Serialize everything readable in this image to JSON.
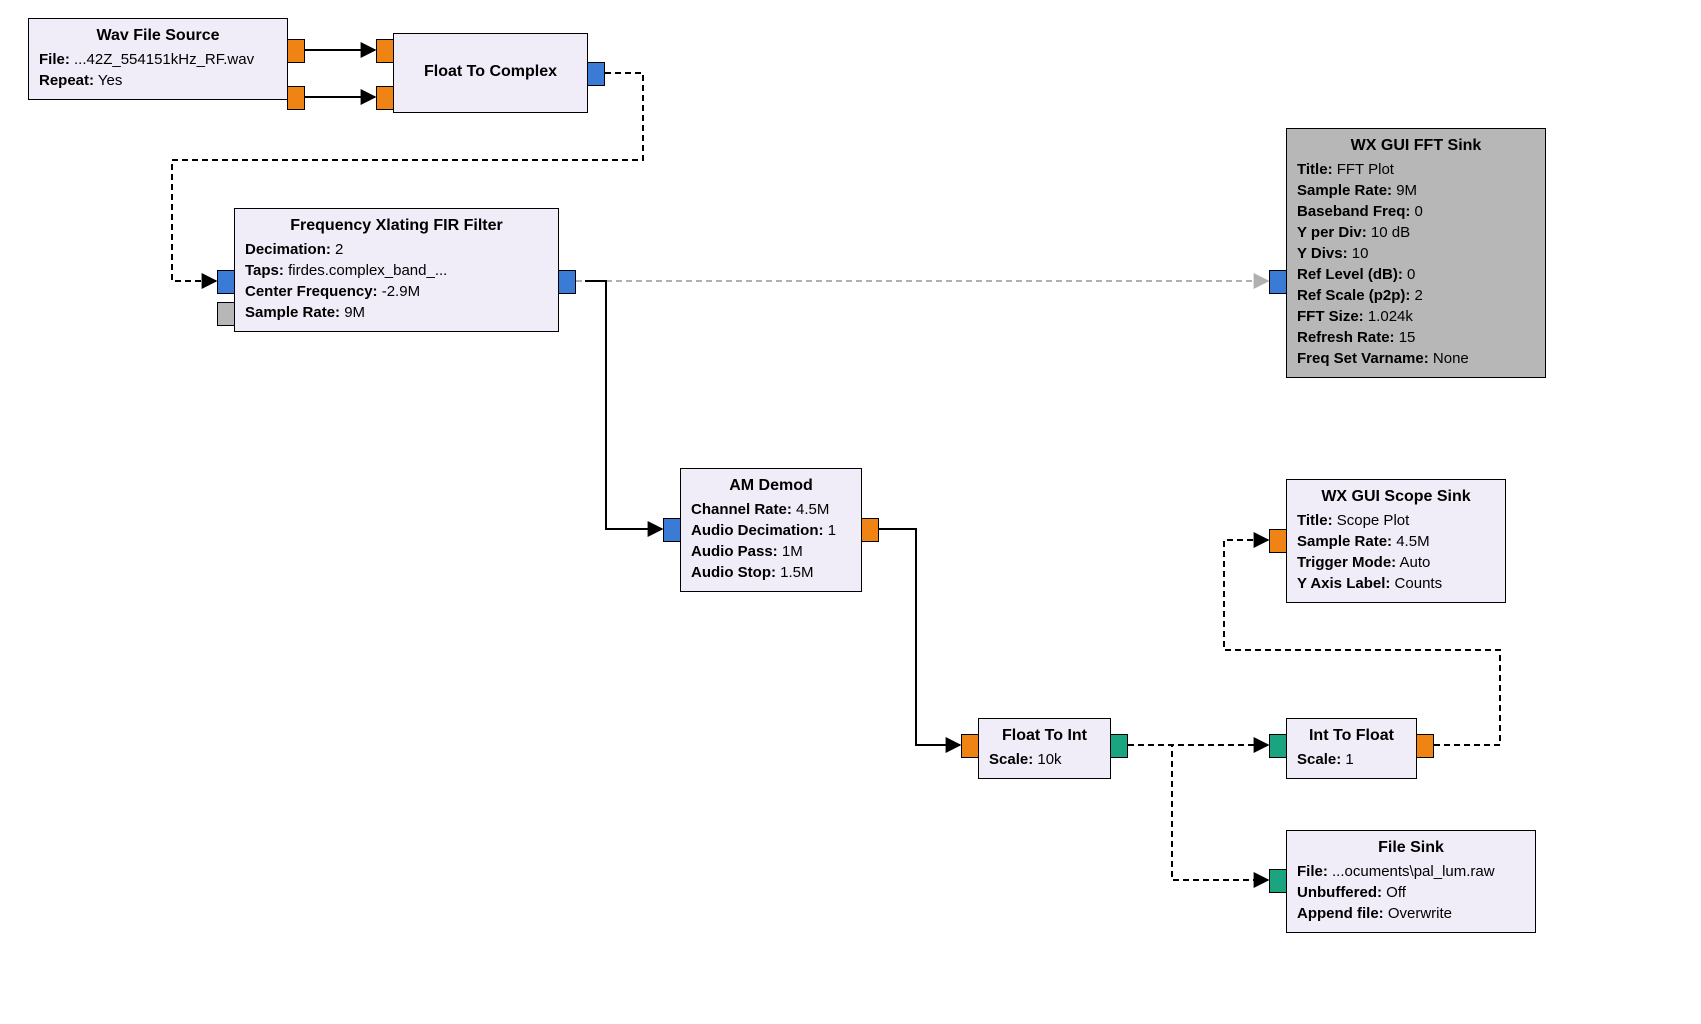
{
  "blocks": {
    "wav": {
      "title": "Wav File Source",
      "props": [
        {
          "k": "File:",
          "v": "...42Z_554151kHz_RF.wav"
        },
        {
          "k": "Repeat:",
          "v": "Yes"
        }
      ]
    },
    "f2c": {
      "title": "Float To Complex",
      "props": []
    },
    "xlate": {
      "title": "Frequency Xlating FIR Filter",
      "props": [
        {
          "k": "Decimation:",
          "v": "2"
        },
        {
          "k": "Taps:",
          "v": "firdes.complex_band_..."
        },
        {
          "k": "Center Frequency:",
          "v": "-2.9M"
        },
        {
          "k": "Sample Rate:",
          "v": "9M"
        }
      ]
    },
    "fft": {
      "title": "WX GUI FFT Sink",
      "props": [
        {
          "k": "Title:",
          "v": "FFT Plot"
        },
        {
          "k": "Sample Rate:",
          "v": "9M"
        },
        {
          "k": "Baseband Freq:",
          "v": "0"
        },
        {
          "k": "Y per Div:",
          "v": "10 dB"
        },
        {
          "k": "Y Divs:",
          "v": "10"
        },
        {
          "k": "Ref Level (dB):",
          "v": "0"
        },
        {
          "k": "Ref Scale (p2p):",
          "v": "2"
        },
        {
          "k": "FFT Size:",
          "v": "1.024k"
        },
        {
          "k": "Refresh Rate:",
          "v": "15"
        },
        {
          "k": "Freq Set Varname:",
          "v": "None"
        }
      ]
    },
    "amdemod": {
      "title": "AM Demod",
      "props": [
        {
          "k": "Channel Rate:",
          "v": "4.5M"
        },
        {
          "k": "Audio Decimation:",
          "v": "1"
        },
        {
          "k": "Audio Pass:",
          "v": "1M"
        },
        {
          "k": "Audio Stop:",
          "v": "1.5M"
        }
      ]
    },
    "scope": {
      "title": "WX GUI Scope Sink",
      "props": [
        {
          "k": "Title:",
          "v": "Scope Plot"
        },
        {
          "k": "Sample Rate:",
          "v": "4.5M"
        },
        {
          "k": "Trigger Mode:",
          "v": "Auto"
        },
        {
          "k": "Y Axis Label:",
          "v": "Counts"
        }
      ]
    },
    "f2i": {
      "title": "Float To Int",
      "props": [
        {
          "k": "Scale:",
          "v": "10k"
        }
      ]
    },
    "i2f": {
      "title": "Int To Float",
      "props": [
        {
          "k": "Scale:",
          "v": "1"
        }
      ]
    },
    "fsink": {
      "title": "File Sink",
      "props": [
        {
          "k": "File:",
          "v": "...ocuments\\pal_lum.raw"
        },
        {
          "k": "Unbuffered:",
          "v": "Off"
        },
        {
          "k": "Append file:",
          "v": "Overwrite"
        }
      ]
    }
  }
}
